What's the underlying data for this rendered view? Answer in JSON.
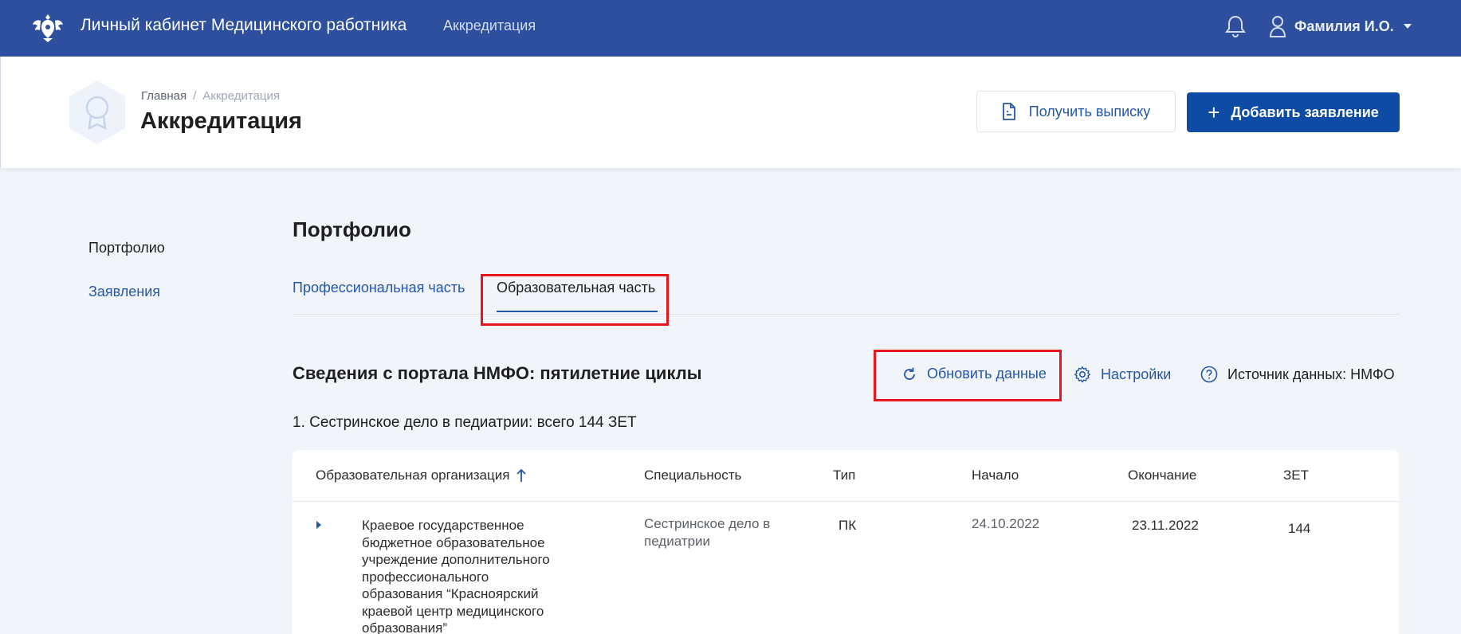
{
  "topbar": {
    "app_title": "Личный кабинет Медицинского работника",
    "nav_link": "Аккредитация",
    "user_name": "Фамилия И.О.",
    "icons": [
      "emblem-icon",
      "bell-icon",
      "user-icon",
      "caret-down-icon"
    ]
  },
  "header": {
    "breadcrumb": {
      "home": "Главная",
      "separator": "/",
      "current": "Аккредитация"
    },
    "title": "Аккредитация",
    "get_statement_label": "Получить выписку",
    "add_application_label": "Добавить заявление",
    "add_symbol": "+"
  },
  "sidebar": {
    "items": [
      {
        "label": "Портфолио",
        "active": true
      },
      {
        "label": "Заявления",
        "active": false
      }
    ]
  },
  "main": {
    "title": "Портфолио",
    "tabs": [
      {
        "label": "Профессиональная часть",
        "selected": false
      },
      {
        "label": "Образовательная часть",
        "selected": true
      }
    ],
    "section_title": "Сведения с портала НМФО: пятилетние циклы",
    "actions": {
      "refresh": "Обновить данные",
      "settings": "Настройки",
      "source": "Источник данных: НМФО"
    },
    "cycle_title": "1. Сестринское дело в педиатрии: всего 144 ЗЕТ",
    "table": {
      "columns": {
        "org": "Образовательная организация",
        "spec": "Специальность",
        "type": "Тип",
        "start": "Начало",
        "end": "Окончание",
        "zet": "ЗЕТ"
      },
      "rows": [
        {
          "org": "Краевое государственное бюджетное образовательное учреждение дополнительного профессионального образования “Красноярский краевой центр медицинского образования”",
          "spec": "Сестринское дело в педиатрии",
          "type": "ПК",
          "start": "24.10.2022",
          "end": "23.11.2022",
          "zet": "144"
        }
      ]
    }
  },
  "colors": {
    "topbar": "#2e4f9d",
    "primary_button": "#0d4ba4",
    "link": "#2356a8",
    "highlight": "#e8141e",
    "background": "#f1f5fa"
  }
}
